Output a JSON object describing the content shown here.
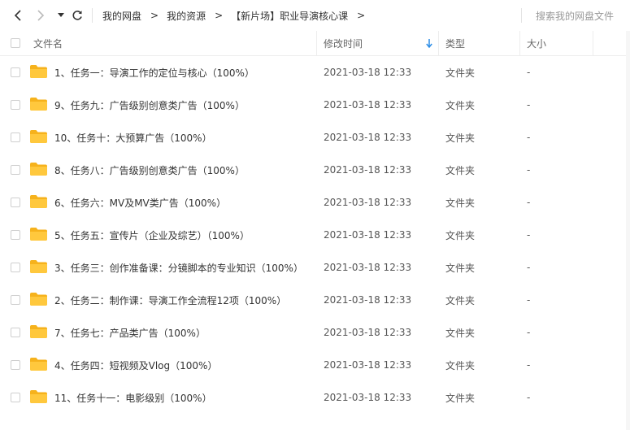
{
  "toolbar": {
    "back_icon": "chevron-left-icon",
    "forward_icon": "chevron-right-icon",
    "history_icon": "caret-down-icon",
    "refresh_icon": "refresh-icon",
    "breadcrumbs": [
      "我的网盘",
      "我的资源",
      "【新片场】职业导演核心课"
    ],
    "separator": ">",
    "search_placeholder": "搜索我的网盘文件"
  },
  "columns": {
    "name": "文件名",
    "modified": "修改时间",
    "sort_icon": "sort-down-arrow-icon",
    "type": "类型",
    "size": "大小"
  },
  "colors": {
    "folder": "#ffc83d",
    "folder_dark": "#f6b21c",
    "accent": "#2b8ce6"
  },
  "files": [
    {
      "name": "1、任务一：导演工作的定位与核心（100%）",
      "modified": "2021-03-18 12:33",
      "type": "文件夹",
      "size": "-"
    },
    {
      "name": "9、任务九：广告级别创意类广告（100%）",
      "modified": "2021-03-18 12:33",
      "type": "文件夹",
      "size": "-"
    },
    {
      "name": "10、任务十：大预算广告（100%）",
      "modified": "2021-03-18 12:33",
      "type": "文件夹",
      "size": "-"
    },
    {
      "name": "8、任务八：广告级别创意类广告（100%）",
      "modified": "2021-03-18 12:33",
      "type": "文件夹",
      "size": "-"
    },
    {
      "name": "6、任务六：MV及MV类广告（100%）",
      "modified": "2021-03-18 12:33",
      "type": "文件夹",
      "size": "-"
    },
    {
      "name": "5、任务五：宣传片（企业及综艺）（100%）",
      "modified": "2021-03-18 12:33",
      "type": "文件夹",
      "size": "-"
    },
    {
      "name": "3、任务三：创作准备课：分镜脚本的专业知识（100%）",
      "modified": "2021-03-18 12:33",
      "type": "文件夹",
      "size": "-"
    },
    {
      "name": "2、任务二：制作课：导演工作全流程12项（100%）",
      "modified": "2021-03-18 12:33",
      "type": "文件夹",
      "size": "-"
    },
    {
      "name": "7、任务七：产品类广告（100%）",
      "modified": "2021-03-18 12:33",
      "type": "文件夹",
      "size": "-"
    },
    {
      "name": "4、任务四：短视频及Vlog（100%）",
      "modified": "2021-03-18 12:33",
      "type": "文件夹",
      "size": "-"
    },
    {
      "name": "11、任务十一：电影级别（100%）",
      "modified": "2021-03-18 12:33",
      "type": "文件夹",
      "size": "-"
    }
  ]
}
